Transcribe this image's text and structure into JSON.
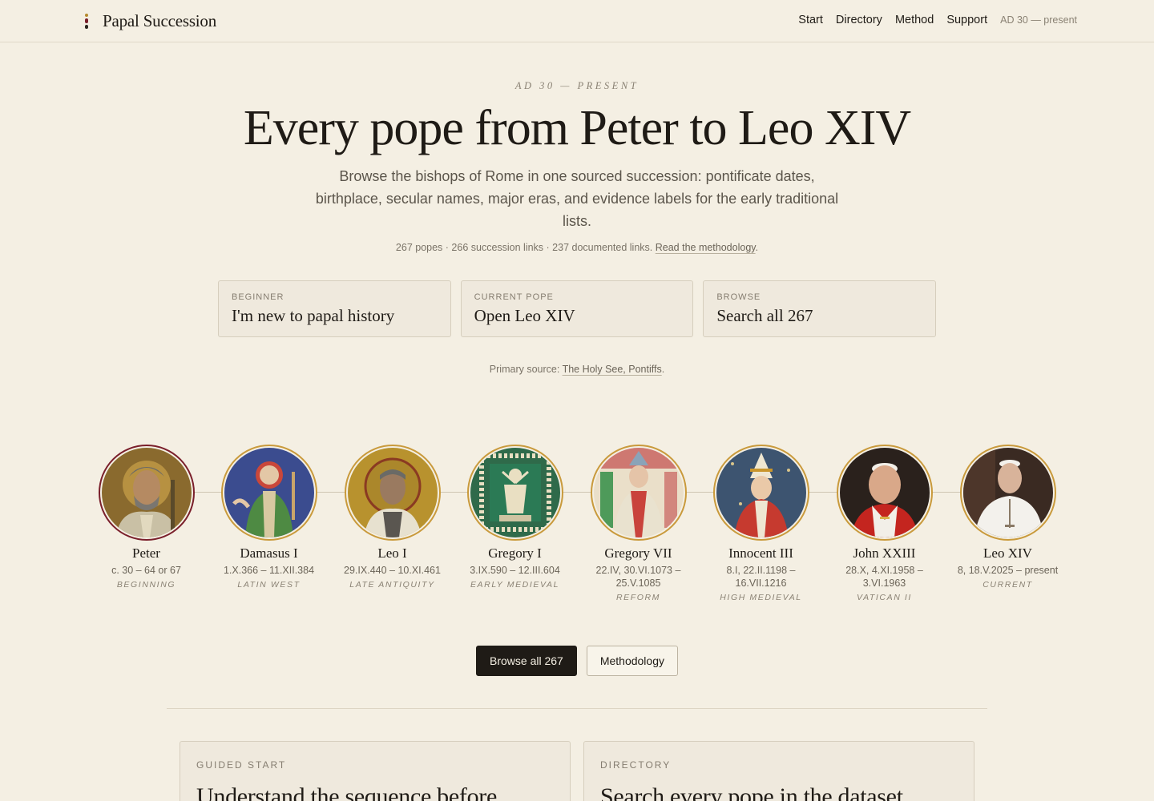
{
  "header": {
    "brand": "Papal Succession",
    "nav": [
      "Start",
      "Directory",
      "Method",
      "Support"
    ],
    "era": "AD 30 — present"
  },
  "hero": {
    "eyebrow": "AD 30 — PRESENT",
    "title": "Every pope from Peter to Leo XIV",
    "subtitle": "Browse the bishops of Rome in one sourced succession: pontificate dates, birthplace, secular names, major eras, and evidence labels for the early traditional lists.",
    "stats_text": "267 popes · 266 succession links · 237 documented links.",
    "stats_link": "Read the methodology",
    "stats_end": "."
  },
  "cards": [
    {
      "kicker": "BEGINNER",
      "label": "I'm new to papal history"
    },
    {
      "kicker": "CURRENT POPE",
      "label": "Open Leo XIV"
    },
    {
      "kicker": "BROWSE",
      "label": "Search all 267"
    }
  ],
  "source": {
    "prefix": "Primary source:",
    "link": "The Holy See, Pontiffs",
    "end": "."
  },
  "timeline": [
    {
      "name": "Peter",
      "dates": "c. 30 – 64 or 67",
      "era": "BEGINNING",
      "active": true,
      "icon": "portrait-peter-mosaic-icon"
    },
    {
      "name": "Damasus I",
      "dates": "1.X.366 – 11.XII.384",
      "era": "LATIN WEST",
      "active": false,
      "icon": "portrait-damasus-icon"
    },
    {
      "name": "Leo I",
      "dates": "29.IX.440 – 10.XI.461",
      "era": "LATE ANTIQUITY",
      "active": false,
      "icon": "portrait-leo-i-icon"
    },
    {
      "name": "Gregory I",
      "dates": "3.IX.590 – 12.III.604",
      "era": "EARLY MEDIEVAL",
      "active": false,
      "icon": "portrait-gregory-i-icon"
    },
    {
      "name": "Gregory VII",
      "dates": "22.IV, 30.VI.1073 – 25.V.1085",
      "era": "REFORM",
      "active": false,
      "icon": "portrait-gregory-vii-icon"
    },
    {
      "name": "Innocent III",
      "dates": "8.I, 22.II.1198 – 16.VII.1216",
      "era": "HIGH MEDIEVAL",
      "active": false,
      "icon": "portrait-innocent-iii-icon"
    },
    {
      "name": "John XXIII",
      "dates": "28.X, 4.XI.1958 – 3.VI.1963",
      "era": "VATICAN II",
      "active": false,
      "icon": "portrait-john-xxiii-icon"
    },
    {
      "name": "Leo XIV",
      "dates": "8, 18.V.2025 – present",
      "era": "CURRENT",
      "active": false,
      "icon": "portrait-leo-xiv-icon"
    }
  ],
  "buttons": {
    "browse": "Browse all 267",
    "method": "Methodology"
  },
  "panels": [
    {
      "kicker": "GUIDED START",
      "title": "Understand the sequence before"
    },
    {
      "kicker": "DIRECTORY",
      "title": "Search every pope in the dataset"
    }
  ],
  "colors": {
    "background": "#f4efe3",
    "accent_gold": "#c99a3c",
    "accent_crimson": "#7a1f2b",
    "ink": "#1f1b16"
  }
}
